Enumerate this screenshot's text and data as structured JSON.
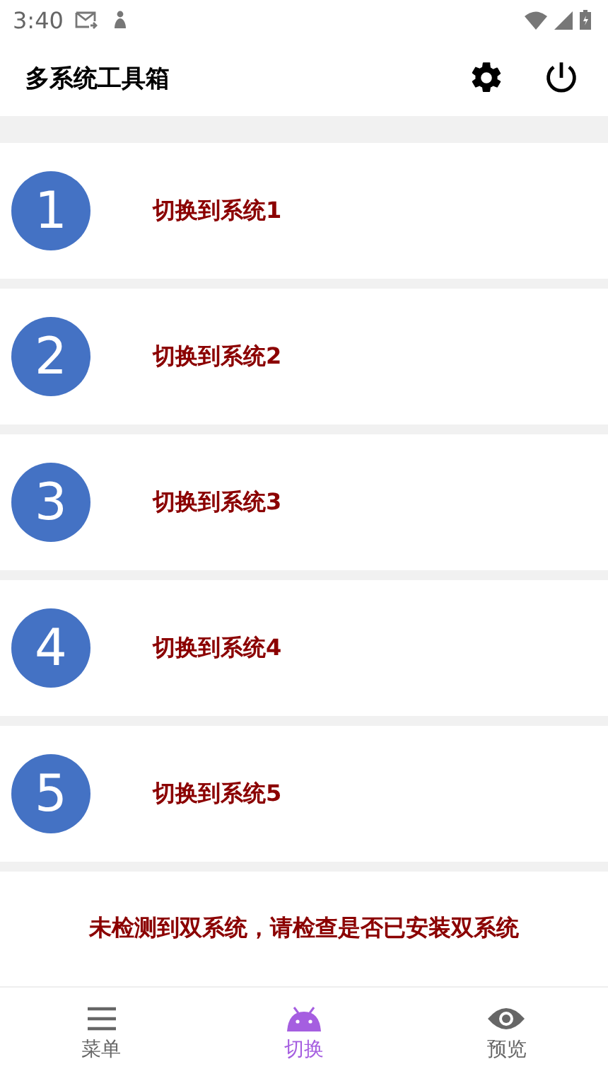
{
  "status_bar": {
    "time": "3:40"
  },
  "app_bar": {
    "title": "多系统工具箱"
  },
  "systems": [
    {
      "number": "1",
      "label": "切换到系统1"
    },
    {
      "number": "2",
      "label": "切换到系统2"
    },
    {
      "number": "3",
      "label": "切换到系统3"
    },
    {
      "number": "4",
      "label": "切换到系统4"
    },
    {
      "number": "5",
      "label": "切换到系统5"
    }
  ],
  "message": "未检测到双系统，请检查是否已安装双系统",
  "bottom_nav": [
    {
      "kind": "menu",
      "label": "菜单",
      "selected": false
    },
    {
      "kind": "android",
      "label": "切换",
      "selected": true
    },
    {
      "kind": "eye",
      "label": "预览",
      "selected": false
    }
  ]
}
